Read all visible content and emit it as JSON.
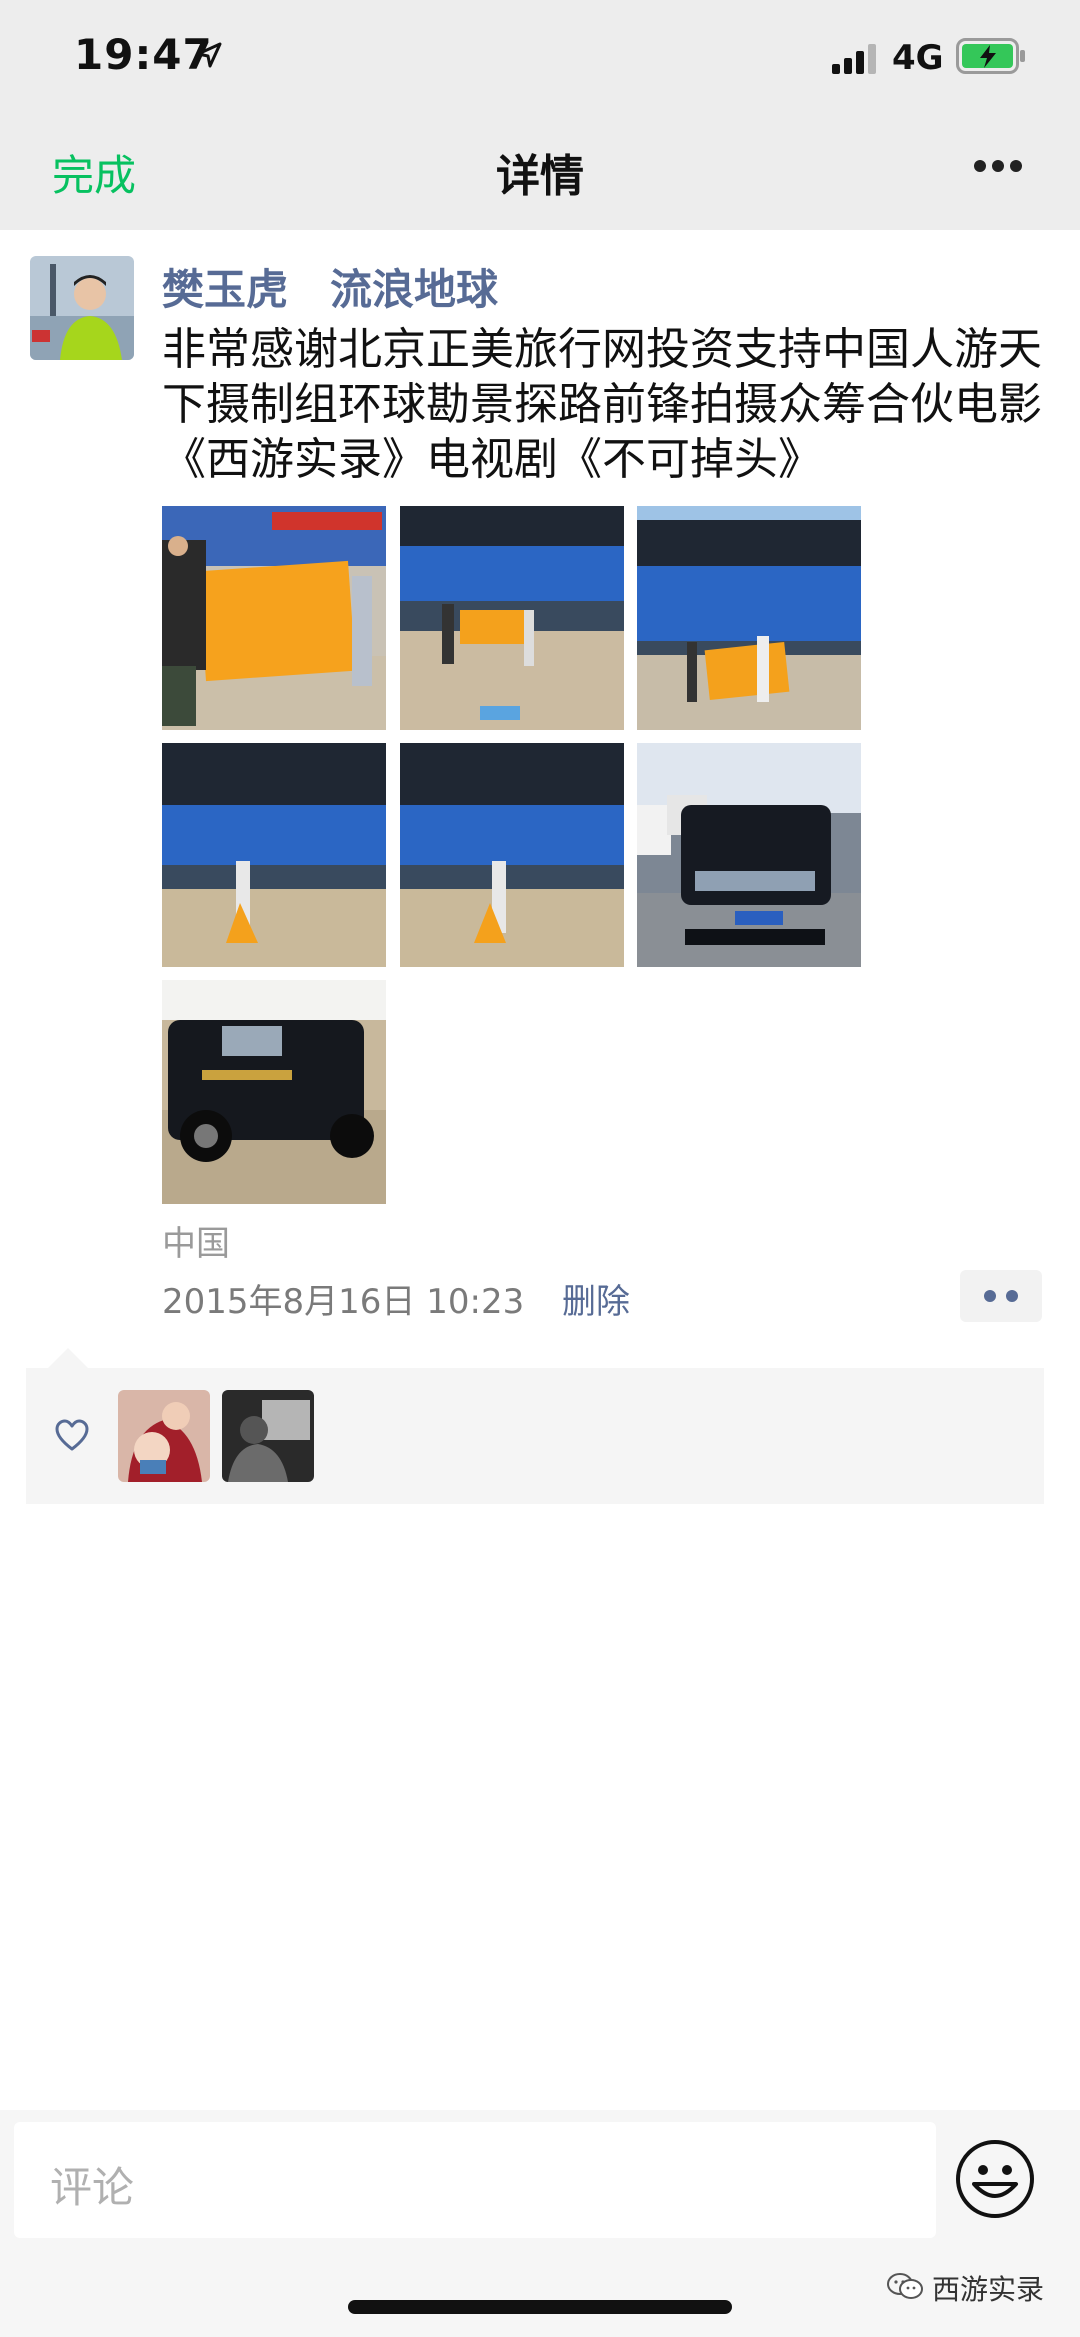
{
  "status": {
    "time": "19:47",
    "network": "4G"
  },
  "nav": {
    "done_label": "完成",
    "title": "详情"
  },
  "post": {
    "author": "樊玉虎　流浪地球",
    "text": "非常感谢北京正美旅行网投资支持中国人游天下摄制组环球勘景探路前锋拍摄众筹合伙电影《西游实录》电视剧《不可掉头》",
    "location": "中国",
    "timestamp": "2015年8月16日 10:23",
    "delete_label": "删除",
    "photos": [
      {
        "name": "photo-1"
      },
      {
        "name": "photo-2"
      },
      {
        "name": "photo-3"
      },
      {
        "name": "photo-4"
      },
      {
        "name": "photo-5"
      },
      {
        "name": "photo-6"
      },
      {
        "name": "photo-7"
      }
    ]
  },
  "likes": {
    "count": 2
  },
  "comment": {
    "placeholder": "评论"
  },
  "watermark": {
    "text": "西游实录"
  },
  "colors": {
    "accent_green": "#07c160",
    "link_blue": "#576b95",
    "nav_bg": "#ededed"
  }
}
